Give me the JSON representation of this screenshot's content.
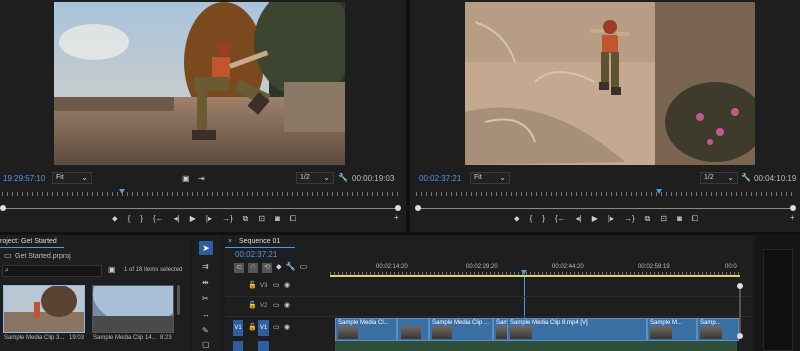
{
  "source_monitor": {
    "timecode": "19:29:57:10",
    "fit": "Fit",
    "resolution": "1/2",
    "duration": "00:00:19:03"
  },
  "program_monitor": {
    "timecode": "00:02:37:21",
    "fit": "Fit",
    "resolution": "1/2",
    "duration": "00:04:10:19"
  },
  "project": {
    "title": "roject: Get Started",
    "file": "Get Started.prproj",
    "selection": "1 of 18 items selected",
    "items": [
      {
        "label": "Sample Media Clip 3...",
        "duration": "19:03"
      },
      {
        "label": "Sample Media Clip 14...",
        "duration": "8:23"
      }
    ]
  },
  "timeline": {
    "tab": "Sequence 01",
    "timecode": "00:02:37:21",
    "ruler": [
      "00:02:14:20",
      "00:02:29:20",
      "00:02:44:20",
      "00:02:59:19",
      "00:0"
    ],
    "tracks": [
      {
        "id": "V3",
        "label": "V3"
      },
      {
        "id": "V2",
        "label": "V2"
      },
      {
        "id": "V1",
        "label": "V1",
        "src": "V1"
      }
    ],
    "clips": [
      {
        "label": "Sample Media Cl..."
      },
      {
        "label": ""
      },
      {
        "label": "Sample Media Clip ..."
      },
      {
        "label": "Sample Media Clip ..."
      },
      {
        "label": "Sample Media Clip 8.mp4 [V]"
      },
      {
        "label": "Sample M..."
      },
      {
        "label": "Samp..."
      }
    ]
  },
  "colors": {
    "accent": "#4b9be6",
    "clip": "#3a6fa4",
    "bg": "#1e1e1e"
  },
  "icons": [
    "marker-icon",
    "in-point-icon",
    "out-point-icon",
    "go-to-in-icon",
    "step-back-icon",
    "play-icon",
    "step-forward-icon",
    "go-to-out-icon",
    "insert-icon",
    "overwrite-icon",
    "export-frame-icon",
    "button-editor-icon",
    "settings-icon",
    "search-icon",
    "lock-icon",
    "eye-icon",
    "selection-tool-icon",
    "track-select-icon",
    "ripple-edit-icon",
    "razor-icon",
    "slip-icon",
    "pen-icon",
    "wrench-icon"
  ]
}
